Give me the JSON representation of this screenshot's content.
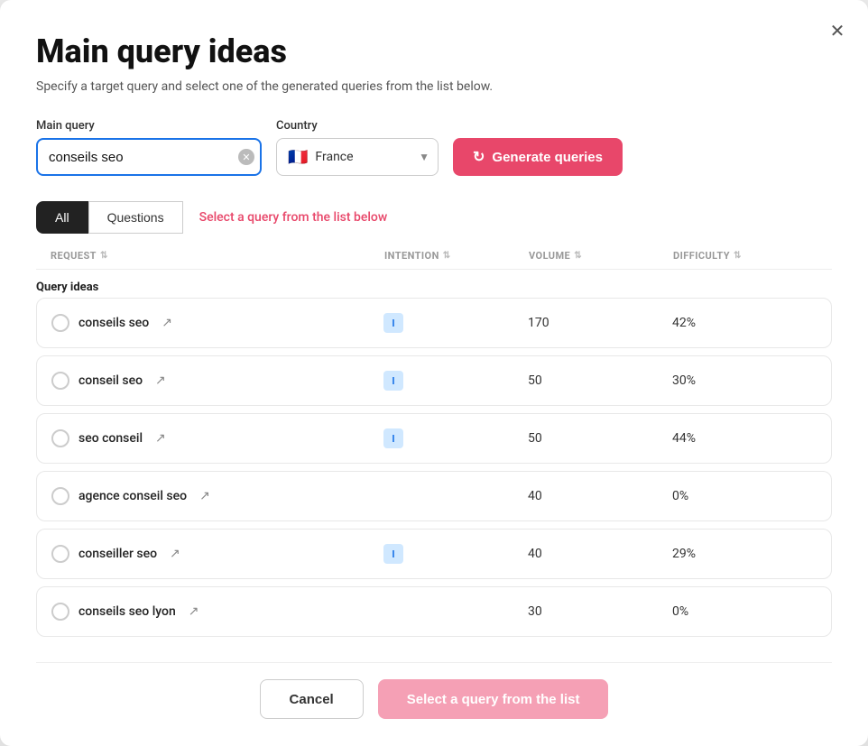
{
  "modal": {
    "title": "Main query ideas",
    "subtitle": "Specify a target query and select one of the generated queries from the list below.",
    "close_label": "✕"
  },
  "form": {
    "main_query_label": "Main query",
    "main_query_value": "conseils seo",
    "country_label": "Country",
    "country_value": "France",
    "country_flag": "🇫🇷",
    "generate_btn_label": "Generate queries"
  },
  "tabs": [
    {
      "id": "all",
      "label": "All",
      "active": true
    },
    {
      "id": "questions",
      "label": "Questions",
      "active": false
    }
  ],
  "tab_hint": "Select a query from the list below",
  "table": {
    "headers": [
      {
        "label": "REQUEST",
        "sortable": true
      },
      {
        "label": "INTENTION",
        "sortable": true
      },
      {
        "label": "VOLUME",
        "sortable": true
      },
      {
        "label": "DIFFICULTY",
        "sortable": true
      }
    ],
    "section_label": "Query ideas",
    "rows": [
      {
        "name": "conseils seo",
        "intention": "I",
        "volume": "170",
        "difficulty": "42%"
      },
      {
        "name": "conseil seo",
        "intention": "I",
        "volume": "50",
        "difficulty": "30%"
      },
      {
        "name": "seo conseil",
        "intention": "I",
        "volume": "50",
        "difficulty": "44%"
      },
      {
        "name": "agence conseil seo",
        "intention": "",
        "volume": "40",
        "difficulty": "0%"
      },
      {
        "name": "conseiller seo",
        "intention": "I",
        "volume": "40",
        "difficulty": "29%"
      },
      {
        "name": "conseils seo lyon",
        "intention": "",
        "volume": "30",
        "difficulty": "0%"
      }
    ]
  },
  "footer": {
    "cancel_label": "Cancel",
    "select_label": "Select a query from the list"
  }
}
